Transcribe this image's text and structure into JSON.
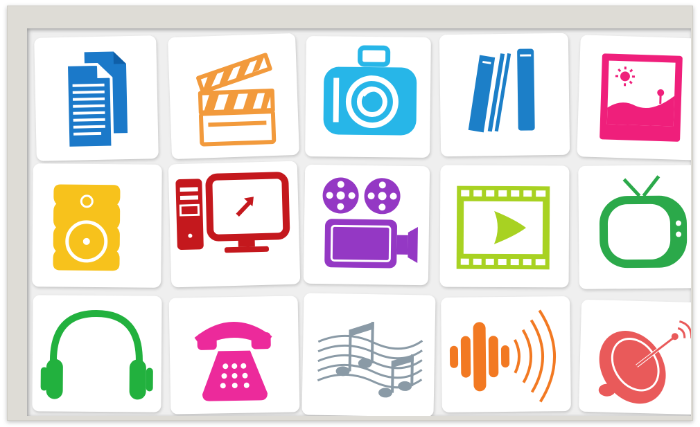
{
  "board": {
    "rows": [
      {
        "icons": [
          {
            "name": "documents-icon",
            "color": "#1b79c9"
          },
          {
            "name": "clapperboard-icon",
            "color": "#f29a3c"
          },
          {
            "name": "camera-icon",
            "color": "#27b6e8"
          },
          {
            "name": "books-icon",
            "color": "#1c7fc8"
          },
          {
            "name": "photo-icon",
            "color": "#ef1f7b"
          }
        ]
      },
      {
        "icons": [
          {
            "name": "speaker-icon",
            "color": "#f7c21c"
          },
          {
            "name": "computer-icon",
            "color": "#c4181d"
          },
          {
            "name": "film-projector-icon",
            "color": "#9438c4"
          },
          {
            "name": "film-strip-play-icon",
            "color": "#a8d222"
          },
          {
            "name": "tv-icon",
            "color": "#2ba94a"
          }
        ]
      },
      {
        "icons": [
          {
            "name": "headphones-icon",
            "color": "#22b13e"
          },
          {
            "name": "telephone-icon",
            "color": "#ec2a9b"
          },
          {
            "name": "music-notes-icon",
            "color": "#8a9aa6"
          },
          {
            "name": "sound-waves-icon",
            "color": "#f27922"
          },
          {
            "name": "satellite-dish-icon",
            "color": "#e95a5a"
          }
        ]
      }
    ],
    "frame_color": "#dedcd6",
    "tile_color": "#ffffff"
  }
}
